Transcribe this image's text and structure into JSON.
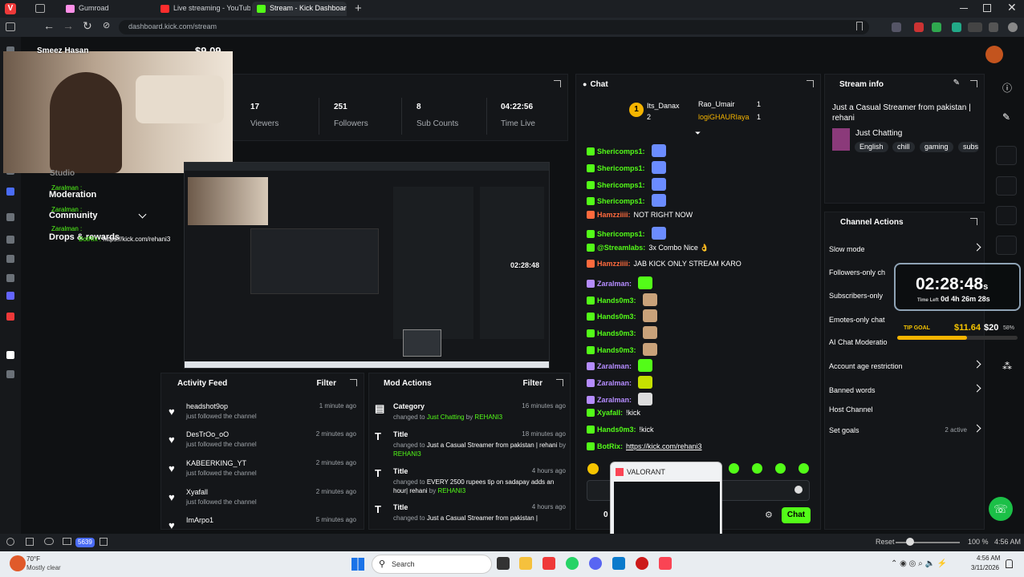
{
  "browser": {
    "tabs": [
      {
        "label": "Gumroad",
        "color": "#ff90e8"
      },
      {
        "label": "Live streaming - YouTube S",
        "color": "#ff2d2d"
      },
      {
        "label": "Stream - Kick Dashboard",
        "color": "#53fc18"
      }
    ],
    "url": "dashboard.kick.com/stream"
  },
  "overlay": {
    "donation": "$9.09",
    "name": "Smeez Hasan"
  },
  "stats": [
    {
      "value": "17",
      "label": "Viewers"
    },
    {
      "value": "251",
      "label": "Followers"
    },
    {
      "value": "8",
      "label": "Sub Counts"
    },
    {
      "value": "04:22:56",
      "label": "Time Live"
    }
  ],
  "leftnav": {
    "studio": "Studio",
    "moderation": "Moderation",
    "community": "Community",
    "drops": "Drops & rewards"
  },
  "overlay_chat": [
    {
      "user": "Zaralman :",
      "text": ""
    },
    {
      "user": "Zaralman :",
      "text": ""
    },
    {
      "user": "Zaralman :",
      "text": ""
    },
    {
      "user": "BotRix :",
      "text": "https://kick.com/rehani3"
    }
  ],
  "activity_feed": {
    "title": "Activity Feed",
    "filter": "Filter",
    "items": [
      {
        "name": "headshot9op",
        "sub": "just followed the channel",
        "time": "1 minute ago"
      },
      {
        "name": "DesTrOo_oO",
        "sub": "just followed the channel",
        "time": "2 minutes ago"
      },
      {
        "name": "KABEERKING_YT",
        "sub": "just followed the channel",
        "time": "2 minutes ago"
      },
      {
        "name": "Xyafall",
        "sub": "just followed the channel",
        "time": "2 minutes ago"
      },
      {
        "name": "ImArpo1",
        "sub": "",
        "time": "5 minutes ago"
      }
    ]
  },
  "mod_actions": {
    "title": "Mod Actions",
    "filter": "Filter",
    "items": [
      {
        "name": "Category",
        "pre": "changed to ",
        "value": "Just Chatting",
        "by": " by ",
        "who": "REHANI3",
        "time": "16 minutes ago"
      },
      {
        "name": "Title",
        "pre": "changed to ",
        "value": "Just a Casual Streamer from pakistan | rehani",
        "by": " by ",
        "who": "REHANI3",
        "time": "18 minutes ago"
      },
      {
        "name": "Title",
        "pre": "changed to ",
        "value": "EVERY 2500 rupees tip on sadapay adds an hour| rehani",
        "by": " by ",
        "who": "REHANI3",
        "time": "4 hours ago"
      },
      {
        "name": "Title",
        "pre": "changed to ",
        "value": "Just a Casual Streamer from pakistan |",
        "by": "",
        "who": "",
        "time": "4 hours ago"
      }
    ]
  },
  "chat": {
    "title": "Chat",
    "leaders": [
      {
        "rank": "1",
        "name": "Its_Danax",
        "count": "2"
      },
      {
        "rank": "",
        "name": "Rao_Umair",
        "count": "1"
      },
      {
        "rank": "",
        "name": "logiGHAURIaya",
        "count": "1"
      }
    ],
    "messages": [
      {
        "user": "Shericomps1:",
        "text": "",
        "color": "#53fc18"
      },
      {
        "user": "Shericomps1:",
        "text": "",
        "color": "#53fc18"
      },
      {
        "user": "Shericomps1:",
        "text": "",
        "color": "#53fc18"
      },
      {
        "user": "Shericomps1:",
        "text": "",
        "color": "#53fc18"
      },
      {
        "user": "Hamzziiii:",
        "text": "NOT RIGHT NOW",
        "color": "#ff6a3d"
      },
      {
        "user": "Shericomps1:",
        "text": "",
        "color": "#53fc18"
      },
      {
        "user": "@Streamlabs:",
        "text": "3x Combo Nice 👌",
        "color": "#53fc18"
      },
      {
        "user": "Hamzziiii:",
        "text": "JAB KICK ONLY STREAM KARO",
        "color": "#ff6a3d"
      },
      {
        "user": "Zaralman:",
        "text": "",
        "color": "#b58cff"
      },
      {
        "user": "Hands0m3:",
        "text": "",
        "color": "#53fc18"
      },
      {
        "user": "Hands0m3:",
        "text": "",
        "color": "#53fc18"
      },
      {
        "user": "Hands0m3:",
        "text": "",
        "color": "#53fc18"
      },
      {
        "user": "Hands0m3:",
        "text": "",
        "color": "#53fc18"
      },
      {
        "user": "Zaralman:",
        "text": "",
        "color": "#b58cff"
      },
      {
        "user": "Zaralman:",
        "text": "",
        "color": "#b58cff"
      },
      {
        "user": "Zaralman:",
        "text": "",
        "color": "#b58cff"
      },
      {
        "user": "Xyafall:",
        "text": "!kick",
        "color": "#53fc18"
      },
      {
        "user": "Hands0m3:",
        "text": "!kick",
        "color": "#53fc18"
      },
      {
        "user": "BotRix:",
        "text": "https://kick.com/rehani3",
        "color": "#53fc18"
      }
    ],
    "send": "Chat",
    "input_count": "0"
  },
  "popup": {
    "title": "VALORANT"
  },
  "stream_info": {
    "title": "Stream info",
    "stream_title": "Just a Casual Streamer from pakistan | rehani",
    "category": "Just Chatting",
    "tags": [
      "English",
      "chill",
      "gaming",
      "subs"
    ]
  },
  "channel_actions": {
    "title": "Channel Actions",
    "items": [
      {
        "label": "Slow mode",
        "extra": ""
      },
      {
        "label": "Followers-only ch",
        "extra": ""
      },
      {
        "label": "Subscribers-only",
        "extra": ""
      },
      {
        "label": "Emotes-only chat",
        "extra": ""
      },
      {
        "label": "AI Chat Moderatio",
        "extra": ""
      },
      {
        "label": "Account age restriction",
        "extra": ""
      },
      {
        "label": "Banned words",
        "extra": ""
      },
      {
        "label": "Host Channel",
        "extra": ""
      },
      {
        "label": "Set goals",
        "extra": "2 active"
      }
    ]
  },
  "timer": {
    "time": "02:28:48",
    "unit": "s",
    "sub_label": "Time Left",
    "sub_value": "0d 4h 26m 28s"
  },
  "tip_goal": {
    "label": "TIP GOAL",
    "current": "$11.64",
    "target": "$20",
    "percent": "58%",
    "progress": 0.58
  },
  "mini_timer": "02:28:48",
  "status_bar": {
    "reset": "Reset",
    "zoom": "100 %",
    "time": "4:56 AM",
    "badge": "5639"
  },
  "taskbar": {
    "weather_temp": "70°F",
    "weather_desc": "Mostly clear",
    "search": "Search",
    "time": "4:56 AM",
    "date": "3/11/2026"
  }
}
